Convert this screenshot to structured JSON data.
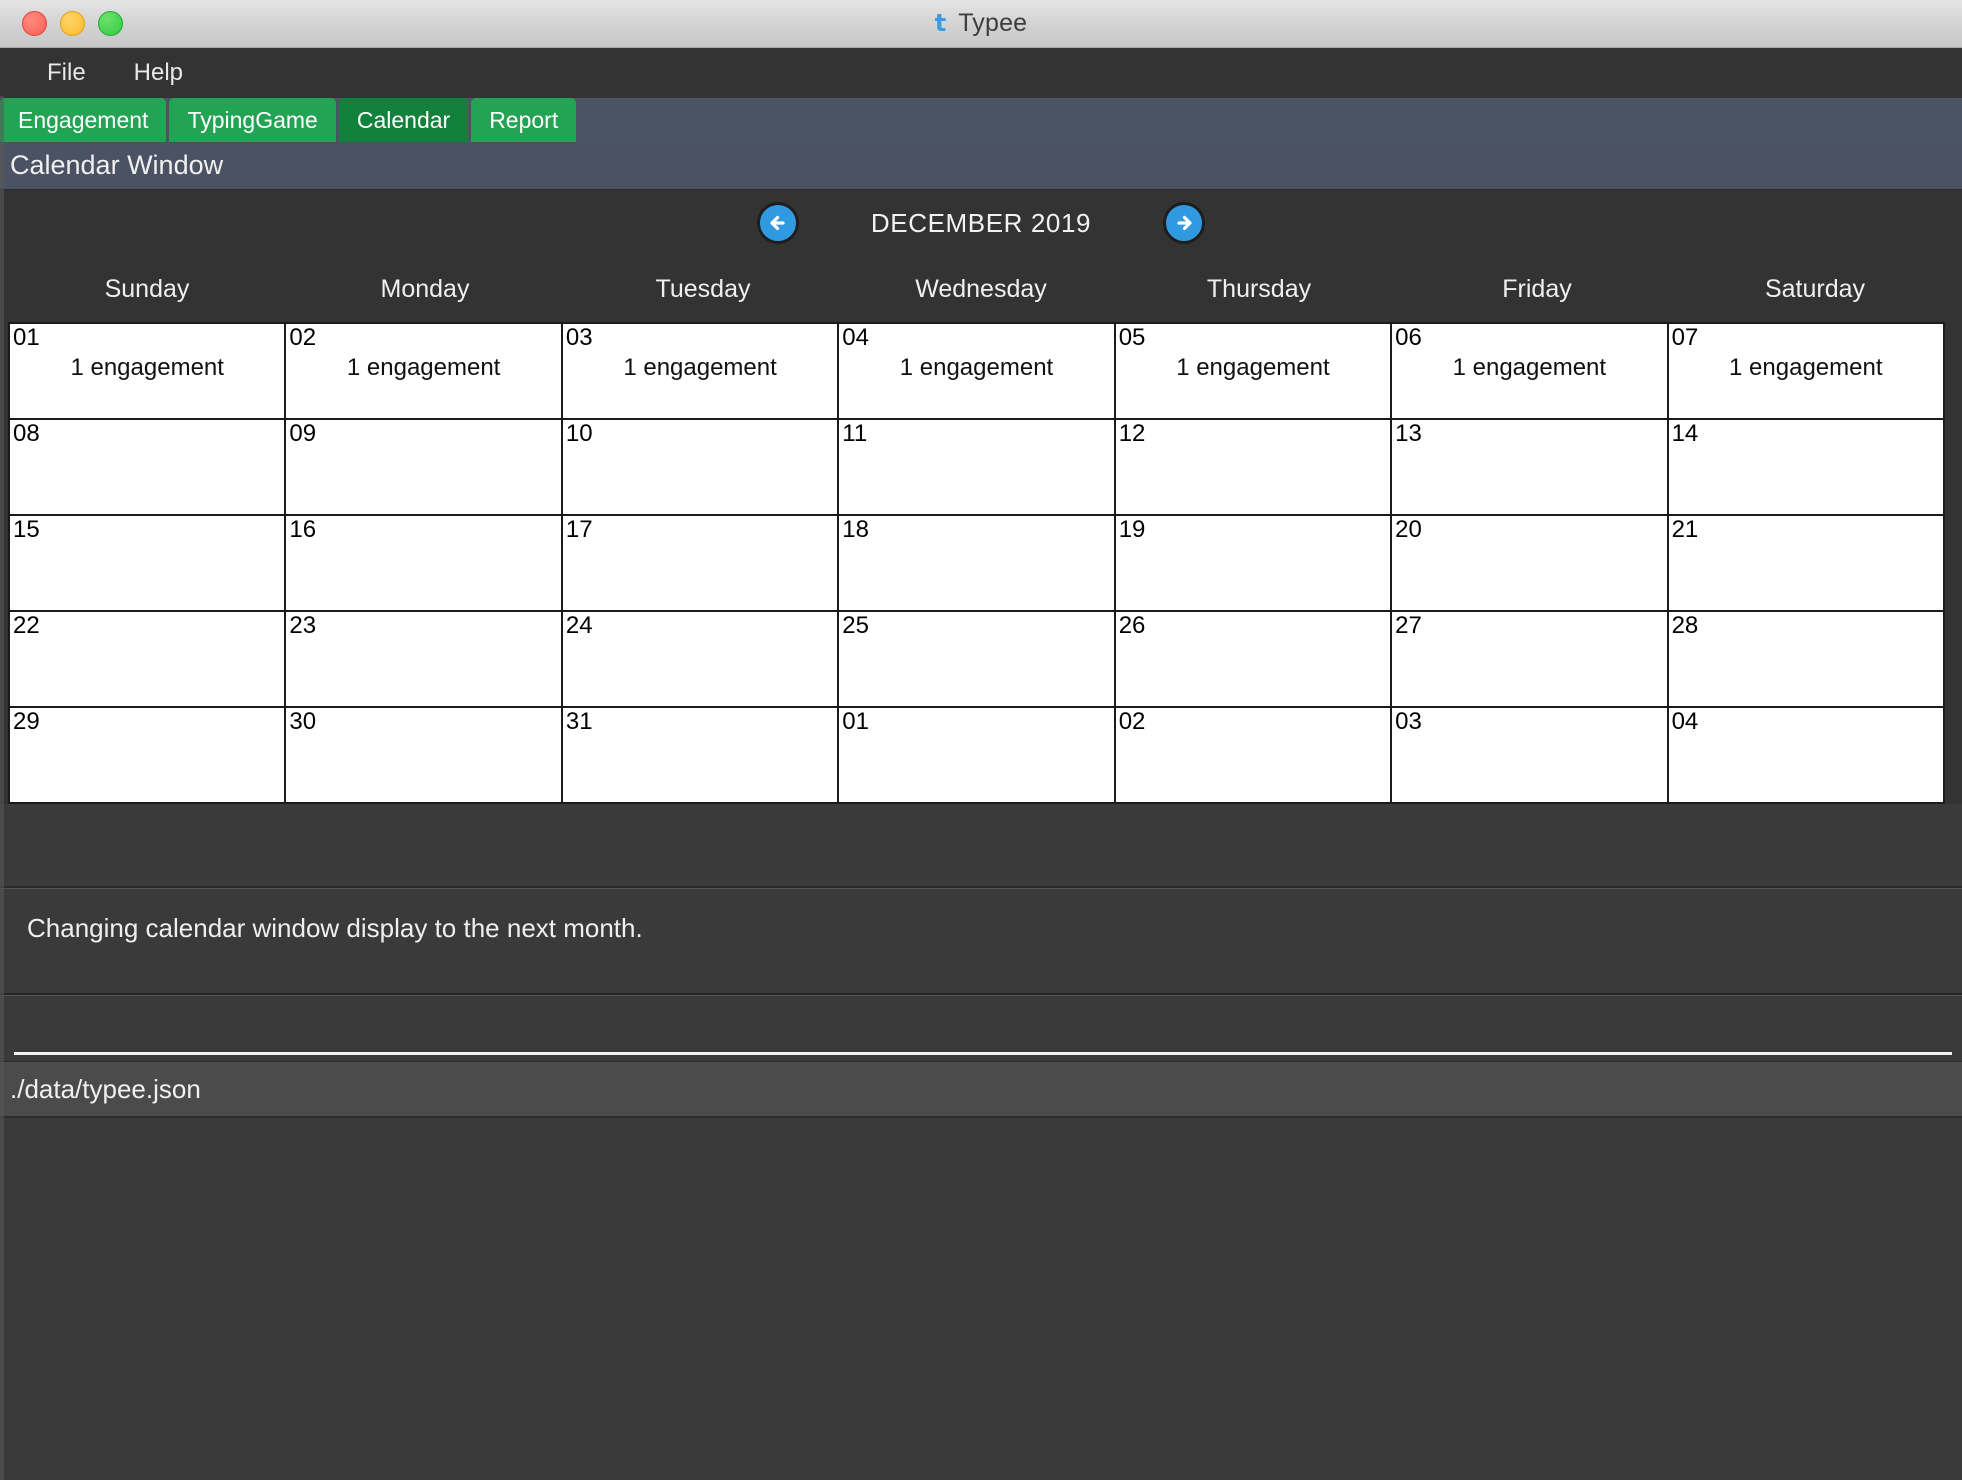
{
  "titlebar": {
    "app_icon": "typee-logo-icon",
    "title": "Typee",
    "window_controls": [
      "close",
      "minimize",
      "maximize"
    ]
  },
  "menubar": {
    "items": [
      {
        "label": "File"
      },
      {
        "label": "Help"
      }
    ]
  },
  "tabs": [
    {
      "label": "Engagement",
      "active": false
    },
    {
      "label": "TypingGame",
      "active": false
    },
    {
      "label": "Calendar",
      "active": true
    },
    {
      "label": "Report",
      "active": false
    }
  ],
  "window_header": {
    "title": "Calendar Window"
  },
  "calendar": {
    "month_label": "DECEMBER 2019",
    "prev_button": "previous-month",
    "next_button": "next-month",
    "weekdays": [
      "Sunday",
      "Monday",
      "Tuesday",
      "Wednesday",
      "Thursday",
      "Friday",
      "Saturday"
    ],
    "weeks": [
      [
        {
          "day": "01",
          "note": "1 engagement"
        },
        {
          "day": "02",
          "note": "1 engagement"
        },
        {
          "day": "03",
          "note": "1 engagement"
        },
        {
          "day": "04",
          "note": "1 engagement"
        },
        {
          "day": "05",
          "note": "1 engagement"
        },
        {
          "day": "06",
          "note": "1 engagement"
        },
        {
          "day": "07",
          "note": "1 engagement"
        }
      ],
      [
        {
          "day": "08",
          "note": ""
        },
        {
          "day": "09",
          "note": ""
        },
        {
          "day": "10",
          "note": ""
        },
        {
          "day": "11",
          "note": ""
        },
        {
          "day": "12",
          "note": ""
        },
        {
          "day": "13",
          "note": ""
        },
        {
          "day": "14",
          "note": ""
        }
      ],
      [
        {
          "day": "15",
          "note": ""
        },
        {
          "day": "16",
          "note": ""
        },
        {
          "day": "17",
          "note": ""
        },
        {
          "day": "18",
          "note": ""
        },
        {
          "day": "19",
          "note": ""
        },
        {
          "day": "20",
          "note": ""
        },
        {
          "day": "21",
          "note": ""
        }
      ],
      [
        {
          "day": "22",
          "note": ""
        },
        {
          "day": "23",
          "note": ""
        },
        {
          "day": "24",
          "note": ""
        },
        {
          "day": "25",
          "note": ""
        },
        {
          "day": "26",
          "note": ""
        },
        {
          "day": "27",
          "note": ""
        },
        {
          "day": "28",
          "note": ""
        }
      ],
      [
        {
          "day": "29",
          "note": ""
        },
        {
          "day": "30",
          "note": ""
        },
        {
          "day": "31",
          "note": ""
        },
        {
          "day": "01",
          "note": ""
        },
        {
          "day": "02",
          "note": ""
        },
        {
          "day": "03",
          "note": ""
        },
        {
          "day": "04",
          "note": ""
        }
      ]
    ]
  },
  "status": {
    "message": "Changing calendar window display to the next month."
  },
  "command_input": {
    "value": "",
    "placeholder": ""
  },
  "path_bar": {
    "path": "./data/typee.json"
  },
  "colors": {
    "tab_green": "#23a455",
    "tab_green_active": "#12813c",
    "header_slate": "#4a5263",
    "nav_blue": "#309ae0",
    "panel_dark": "#3a3a3a",
    "cell_white": "#ffffff"
  }
}
